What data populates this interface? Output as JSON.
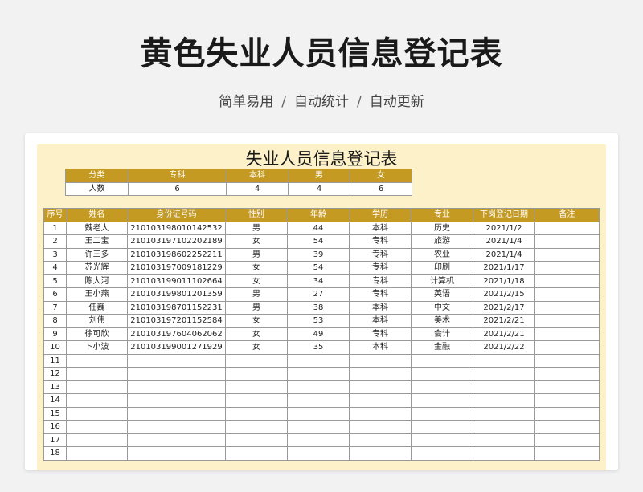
{
  "hero": {
    "title": "黄色失业人员信息登记表",
    "subtitle": [
      "简单易用",
      "自动统计",
      "自动更新"
    ],
    "separator": "/"
  },
  "sheet": {
    "title": "失业人员信息登记表",
    "colors": {
      "header_bg": "#c49a22",
      "sheet_bg": "#fdf1c9"
    }
  },
  "summary": {
    "headers": [
      "分类",
      "专科",
      "本科",
      "男",
      "女"
    ],
    "row": [
      "人数",
      "6",
      "4",
      "4",
      "6"
    ]
  },
  "table": {
    "headers": [
      "序号",
      "姓名",
      "身份证号码",
      "性别",
      "年龄",
      "学历",
      "专业",
      "下岗登记日期",
      "备注"
    ],
    "rows": [
      [
        "1",
        "魏老大",
        "210103198010142532",
        "男",
        "44",
        "本科",
        "历史",
        "2021/1/2",
        ""
      ],
      [
        "2",
        "王二宝",
        "210103197102202189",
        "女",
        "54",
        "专科",
        "旅游",
        "2021/1/4",
        ""
      ],
      [
        "3",
        "许三多",
        "210103198602252211",
        "男",
        "39",
        "专科",
        "农业",
        "2021/1/4",
        ""
      ],
      [
        "4",
        "苏光辉",
        "210103197009181229",
        "女",
        "54",
        "专科",
        "印刷",
        "2021/1/17",
        ""
      ],
      [
        "5",
        "陈大河",
        "210103199011102664",
        "女",
        "34",
        "专科",
        "计算机",
        "2021/1/18",
        ""
      ],
      [
        "6",
        "王小燕",
        "210103199801201359",
        "男",
        "27",
        "专科",
        "英语",
        "2021/2/15",
        ""
      ],
      [
        "7",
        "任巍",
        "210103198701152231",
        "男",
        "38",
        "本科",
        "中文",
        "2021/2/17",
        ""
      ],
      [
        "8",
        "刘伟",
        "210103197201152584",
        "女",
        "53",
        "本科",
        "美术",
        "2021/2/21",
        ""
      ],
      [
        "9",
        "徐可欣",
        "210103197604062062",
        "女",
        "49",
        "专科",
        "会计",
        "2021/2/21",
        ""
      ],
      [
        "10",
        "卜小波",
        "210103199001271929",
        "女",
        "35",
        "本科",
        "金融",
        "2021/2/22",
        ""
      ],
      [
        "11",
        "",
        "",
        "",
        "",
        "",
        "",
        "",
        ""
      ],
      [
        "12",
        "",
        "",
        "",
        "",
        "",
        "",
        "",
        ""
      ],
      [
        "13",
        "",
        "",
        "",
        "",
        "",
        "",
        "",
        ""
      ],
      [
        "14",
        "",
        "",
        "",
        "",
        "",
        "",
        "",
        ""
      ],
      [
        "15",
        "",
        "",
        "",
        "",
        "",
        "",
        "",
        ""
      ],
      [
        "16",
        "",
        "",
        "",
        "",
        "",
        "",
        "",
        ""
      ],
      [
        "17",
        "",
        "",
        "",
        "",
        "",
        "",
        "",
        ""
      ],
      [
        "18",
        "",
        "",
        "",
        "",
        "",
        "",
        "",
        ""
      ]
    ]
  }
}
